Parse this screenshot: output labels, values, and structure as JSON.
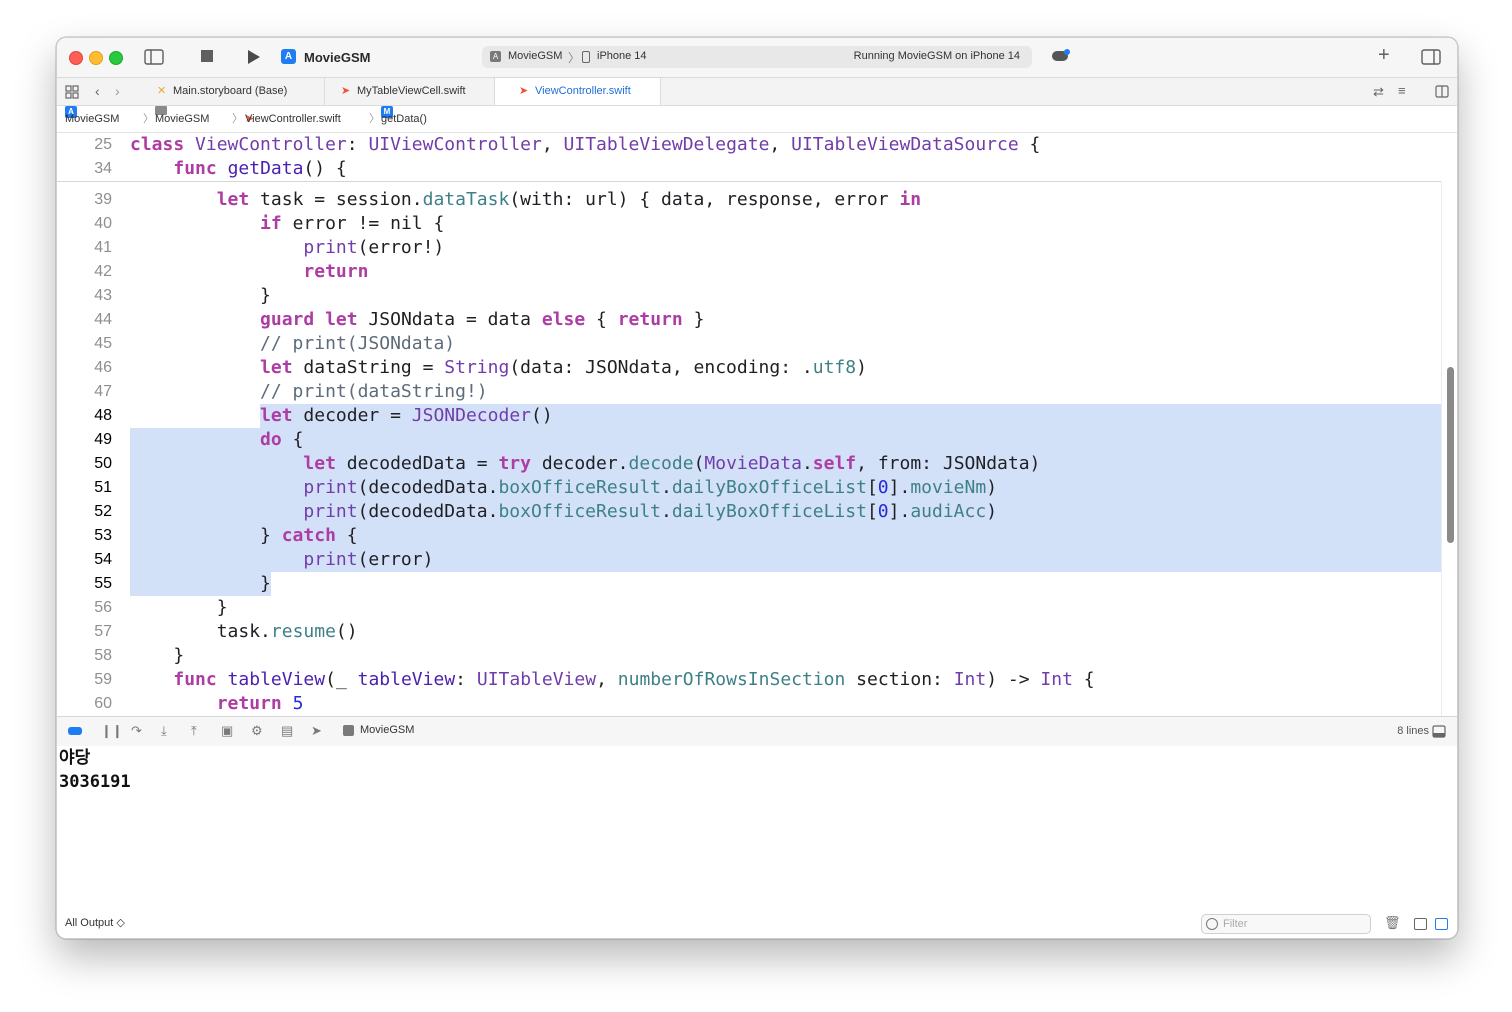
{
  "titlebar": {
    "app_title": "MovieGSM",
    "scheme_name": "MovieGSM",
    "scheme_separator": "〉",
    "device": "iPhone 14",
    "status": "Running MovieGSM on iPhone 14",
    "add_label": "+"
  },
  "tabs": [
    {
      "label": "Main.storyboard (Base)",
      "icon": "storyboard-icon",
      "active": false
    },
    {
      "label": "MyTableViewCell.swift",
      "icon": "swift-file-icon",
      "active": false
    },
    {
      "label": "ViewController.swift",
      "icon": "swift-file-icon",
      "active": true
    }
  ],
  "breadcrumb": {
    "project": "MovieGSM",
    "folder": "MovieGSM",
    "file": "ViewController.swift",
    "symbol_badge": "M",
    "symbol": "getData()",
    "separator": "〉"
  },
  "editor": {
    "sticky_lines": [
      {
        "num": "25",
        "text": "class ViewController: UIViewController, UITableViewDelegate, UITableViewDataSource {"
      },
      {
        "num": "34",
        "text": "    func getData() {"
      }
    ],
    "lines": [
      {
        "num": "39",
        "text": "        let task = session.dataTask(with: url) { data, response, error in"
      },
      {
        "num": "40",
        "text": "            if error != nil {"
      },
      {
        "num": "41",
        "text": "                print(error!)"
      },
      {
        "num": "42",
        "text": "                return"
      },
      {
        "num": "43",
        "text": "            }"
      },
      {
        "num": "44",
        "text": "            guard let JSONdata = data else { return }"
      },
      {
        "num": "45",
        "text": "            // print(JSONdata)"
      },
      {
        "num": "46",
        "text": "            let dataString = String(data: JSONdata, encoding: .utf8)"
      },
      {
        "num": "47",
        "text": "            // print(dataString!)"
      },
      {
        "num": "48",
        "text": "            let decoder = JSONDecoder()"
      },
      {
        "num": "49",
        "text": "            do {"
      },
      {
        "num": "50",
        "text": "                let decodedData = try decoder.decode(MovieData.self, from: JSONdata)"
      },
      {
        "num": "51",
        "text": "                print(decodedData.boxOfficeResult.dailyBoxOfficeList[0].movieNm)"
      },
      {
        "num": "52",
        "text": "                print(decodedData.boxOfficeResult.dailyBoxOfficeList[0].audiAcc)"
      },
      {
        "num": "53",
        "text": "            } catch {"
      },
      {
        "num": "54",
        "text": "                print(error)"
      },
      {
        "num": "55",
        "text": "            }"
      },
      {
        "num": "56",
        "text": "        }"
      },
      {
        "num": "57",
        "text": "        task.resume()"
      },
      {
        "num": "58",
        "text": "    }"
      },
      {
        "num": "59",
        "text": "    func tableView(_ tableView: UITableView, numberOfRowsInSection section: Int) -> Int {"
      },
      {
        "num": "60",
        "text": "        return 5"
      }
    ],
    "selected_line_range": [
      "48",
      "55"
    ]
  },
  "debug": {
    "process": "MovieGSM",
    "line_count": "8 lines"
  },
  "console": {
    "output": [
      "야당",
      "3036191"
    ],
    "filter_selector": "All Output ◇",
    "filter_placeholder": "Filter"
  },
  "colors": {
    "keyword": "#ad3da4",
    "type": "#703daa",
    "function": "#4b21b0",
    "property": "#3e8087",
    "comment": "#5d6c79",
    "number": "#272ad8",
    "selection": "#d3e1f8",
    "accent": "#1f7cf2"
  }
}
